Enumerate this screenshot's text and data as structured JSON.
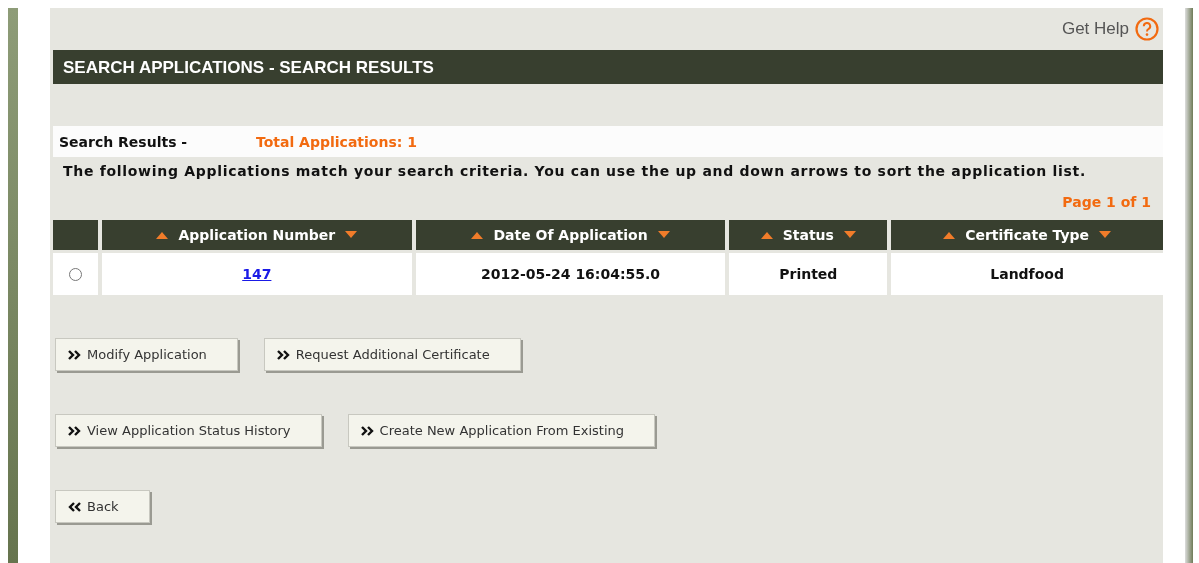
{
  "help": {
    "label": "Get Help"
  },
  "page_title": "SEARCH APPLICATIONS - SEARCH RESULTS",
  "results": {
    "label": "Search Results -",
    "total": "Total Applications: 1"
  },
  "description": "The following Applications match your search criteria. You can use the up and down arrows to sort the application list.",
  "pagination": "Page 1 of 1",
  "table": {
    "columns": [
      "Application Number",
      "Date Of Application",
      "Status",
      "Certificate Type"
    ],
    "rows": [
      {
        "selected": false,
        "cells": [
          "147",
          "2012-05-24 16:04:55.0",
          "Printed",
          "Landfood"
        ]
      }
    ]
  },
  "button_rows": [
    [
      {
        "label": "Modify Application",
        "kind": "forward"
      },
      {
        "label": "Request Additional Certificate",
        "kind": "forward"
      }
    ],
    [
      {
        "label": "View Application Status History",
        "kind": "forward"
      },
      {
        "label": "Create New Application From Existing",
        "kind": "forward"
      }
    ],
    [
      {
        "label": "Back",
        "kind": "back"
      }
    ]
  ]
}
